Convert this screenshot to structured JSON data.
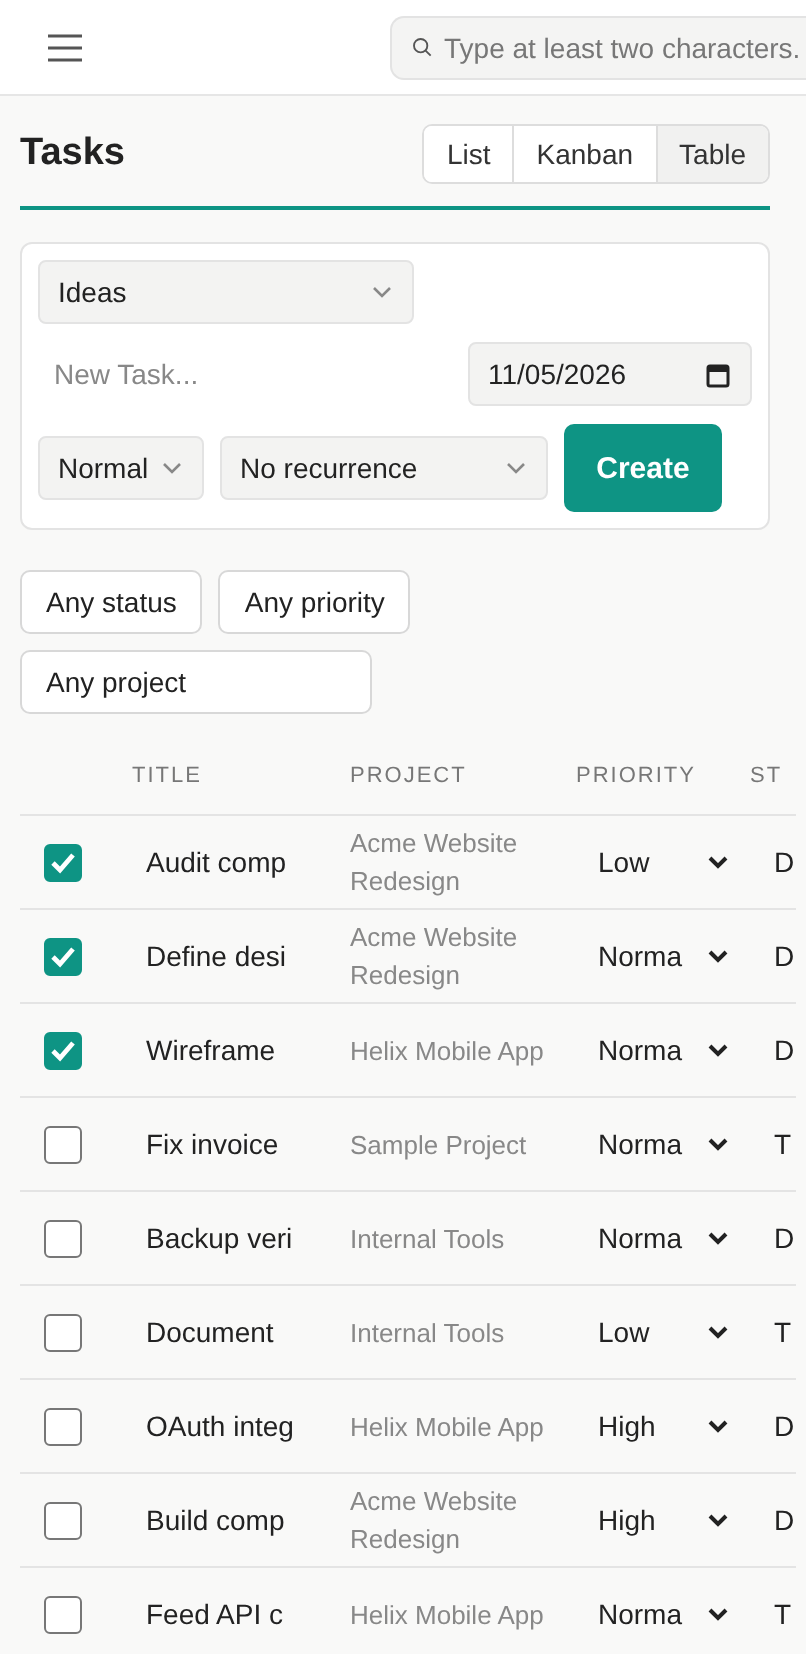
{
  "header": {
    "search": {
      "placeholder": "Type at least two characters."
    }
  },
  "page": {
    "title": "Tasks",
    "views": [
      {
        "label": "List",
        "selected": false
      },
      {
        "label": "Kanban",
        "selected": false
      },
      {
        "label": "Table",
        "selected": true
      }
    ]
  },
  "new_task": {
    "project": "Ideas",
    "title_placeholder": "New Task...",
    "due_date": "11/05/2026",
    "priority": "Normal",
    "recurrence": "No recurrence",
    "submit": "Create"
  },
  "filters": [
    "Any status",
    "Any priority",
    "Any project"
  ],
  "table": {
    "columns": [
      "TITLE",
      "PROJECT",
      "PRIORITY",
      "ST"
    ],
    "rows": [
      {
        "checked": true,
        "title": "Audit comp",
        "project": "Acme Website Redesign",
        "priority": "Low",
        "status": "D"
      },
      {
        "checked": true,
        "title": "Define desi",
        "project": "Acme Website Redesign",
        "priority": "Norma",
        "status": "D"
      },
      {
        "checked": true,
        "title": "Wireframe",
        "project": "Helix Mobile App",
        "priority": "Norma",
        "status": "D"
      },
      {
        "checked": false,
        "title": "Fix invoice",
        "project": "Sample Project",
        "priority": "Norma",
        "status": "T"
      },
      {
        "checked": false,
        "title": "Backup veri",
        "project": "Internal Tools",
        "priority": "Norma",
        "status": "D"
      },
      {
        "checked": false,
        "title": "Document",
        "project": "Internal Tools",
        "priority": "Low",
        "status": "T"
      },
      {
        "checked": false,
        "title": "OAuth integ",
        "project": "Helix Mobile App",
        "priority": "High",
        "status": "D"
      },
      {
        "checked": false,
        "title": "Build comp",
        "project": "Acme Website Redesign",
        "priority": "High",
        "status": "D"
      },
      {
        "checked": false,
        "title": "Feed API c",
        "project": "Helix Mobile App",
        "priority": "Norma",
        "status": "T"
      }
    ]
  }
}
